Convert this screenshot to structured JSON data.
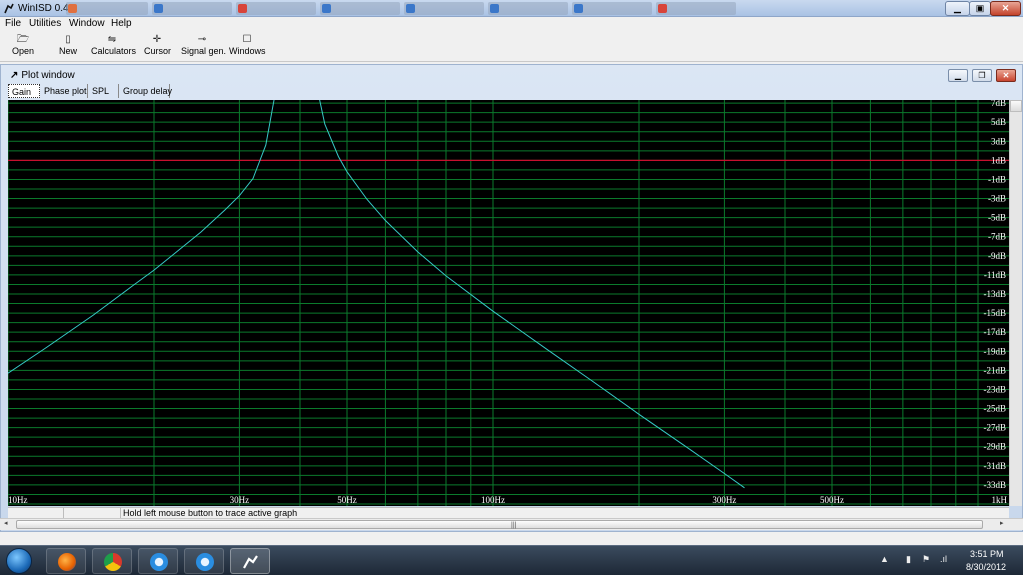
{
  "window": {
    "title": "WinISD 0.44"
  },
  "menu": {
    "items": [
      "File",
      "Utilities",
      "Window",
      "Help"
    ]
  },
  "toolbar": {
    "buttons": [
      {
        "label": "Open",
        "icon": "folder-icon"
      },
      {
        "label": "New",
        "icon": "new-document-icon"
      },
      {
        "label": "Calculators",
        "icon": "calculator-icon"
      },
      {
        "label": "Cursor",
        "icon": "cursor-icon"
      },
      {
        "label": "Signal gen.",
        "icon": "signal-generator-icon"
      },
      {
        "label": "Windows",
        "icon": "windows-icon"
      }
    ]
  },
  "plot_window": {
    "title": "Plot window",
    "tabs": [
      "Gain",
      "Phase plot",
      "SPL",
      "Group delay"
    ],
    "active_tab": "Gain",
    "status_text": "Hold left mouse button to trace active graph"
  },
  "chart_data": {
    "type": "line",
    "x_scale": "log",
    "xlim": [
      10,
      1000
    ],
    "x_tick_labels": [
      "10Hz",
      "30Hz",
      "50Hz",
      "100Hz",
      "300Hz",
      "500Hz",
      "1kH"
    ],
    "x_tick_values": [
      10,
      30,
      50,
      100,
      300,
      500,
      1000
    ],
    "ylim": [
      -35,
      9
    ],
    "y_tick_labels": [
      "7dB",
      "5dB",
      "3dB",
      "1dB",
      "-1dB",
      "-3dB",
      "-5dB",
      "-7dB",
      "-9dB",
      "-11dB",
      "-13dB",
      "-15dB",
      "-17dB",
      "-19dB",
      "-21dB",
      "-23dB",
      "-25dB",
      "-27dB",
      "-29dB",
      "-31dB",
      "-33dB"
    ],
    "y_tick_values": [
      7,
      5,
      3,
      1,
      -1,
      -3,
      -5,
      -7,
      -9,
      -11,
      -13,
      -15,
      -17,
      -19,
      -21,
      -23,
      -25,
      -27,
      -29,
      -31,
      -33
    ],
    "reference_line_db": 1,
    "grid": true,
    "colors": {
      "background": "#000000",
      "grid": "#0b7a2c",
      "reference": "#c8102e",
      "curve": "#36c9c6",
      "tick_text": "#ffffff"
    },
    "series": [
      {
        "x": [
          10,
          12,
          15,
          18,
          20,
          22,
          25,
          28,
          30,
          32,
          34,
          36
        ],
        "y": [
          -21.3,
          -18.6,
          -15.2,
          -12.2,
          -10.5,
          -8.8,
          -6.5,
          -4.2,
          -2.7,
          -0.9,
          2.6,
          9.5
        ]
      },
      {
        "x": [
          43,
          45,
          48,
          50,
          55,
          60,
          70,
          80,
          100,
          130,
          160,
          200,
          250,
          300,
          330
        ],
        "y": [
          9.5,
          4.8,
          1.4,
          -0.2,
          -3.1,
          -5.3,
          -8.6,
          -11.1,
          -14.8,
          -18.9,
          -22.1,
          -25.6,
          -29.0,
          -31.8,
          -33.3
        ]
      }
    ]
  },
  "taskbar": {
    "apps": [
      {
        "name": "firefox",
        "color": "#e66000"
      },
      {
        "name": "chrome",
        "color": "#d9392b"
      },
      {
        "name": "itunes",
        "color": "#2a8de0"
      },
      {
        "name": "itunes",
        "color": "#2a8de0"
      },
      {
        "name": "winisd",
        "color": "#ffffff"
      }
    ],
    "time": "3:51 PM",
    "date": "8/30/2012"
  }
}
